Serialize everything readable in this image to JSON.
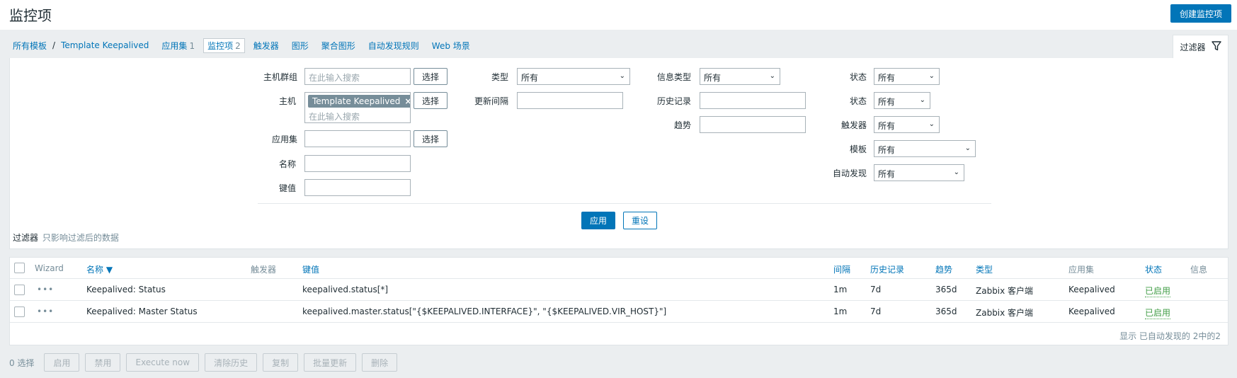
{
  "header": {
    "title": "监控项",
    "create_button": "创建监控项"
  },
  "nav": {
    "breadcrumb": [
      "所有模板",
      "Template Keepalived"
    ],
    "tabs": [
      {
        "label": "应用集",
        "count": "1"
      },
      {
        "label": "监控项",
        "count": "2",
        "active": true
      },
      {
        "label": "触发器"
      },
      {
        "label": "图形"
      },
      {
        "label": "聚合图形"
      },
      {
        "label": "自动发现规则"
      },
      {
        "label": "Web 场景"
      }
    ]
  },
  "filter_tab": {
    "label": "过滤器",
    "icon": "funnel-icon"
  },
  "filter": {
    "host_group": {
      "label": "主机群组",
      "placeholder": "在此输入搜索",
      "select": "选择"
    },
    "host": {
      "label": "主机",
      "tag": "Template Keepalived",
      "placeholder": "在此输入搜索",
      "select": "选择"
    },
    "application": {
      "label": "应用集",
      "value": "",
      "select": "选择"
    },
    "name": {
      "label": "名称",
      "value": ""
    },
    "key": {
      "label": "键值",
      "value": ""
    },
    "type": {
      "label": "类型",
      "value": "所有"
    },
    "update_interval": {
      "label": "更新间隔",
      "value": ""
    },
    "info_type": {
      "label": "信息类型",
      "value": "所有"
    },
    "history": {
      "label": "历史记录",
      "value": ""
    },
    "trends": {
      "label": "趋势",
      "value": ""
    },
    "status": {
      "label": "状态",
      "value": "所有"
    },
    "state": {
      "label": "状态",
      "value": "所有"
    },
    "triggers": {
      "label": "触发器",
      "value": "所有"
    },
    "template": {
      "label": "模板",
      "value": "所有"
    },
    "discovered": {
      "label": "自动发现",
      "value": "所有"
    },
    "apply": "应用",
    "reset": "重设"
  },
  "filter_note": {
    "key": "过滤器",
    "value": "只影响过滤后的数据"
  },
  "table": {
    "headers": {
      "wizard": "Wizard",
      "name": "名称 ▼",
      "triggers": "触发器",
      "key": "键值",
      "interval": "间隔",
      "history": "历史记录",
      "trends": "趋势",
      "type": "类型",
      "applications": "应用集",
      "status": "状态",
      "info": "信息"
    },
    "rows": [
      {
        "wizard": "•••",
        "name": "Keepalived: Status",
        "triggers": "",
        "key": "keepalived.status[*]",
        "interval": "1m",
        "history": "7d",
        "trends": "365d",
        "type": "Zabbix 客户端",
        "applications": "Keepalived",
        "status": "已启用"
      },
      {
        "wizard": "•••",
        "name": "Keepalived: Master Status",
        "triggers": "",
        "key": "keepalived.master.status[\"{$KEEPALIVED.INTERFACE}\", \"{$KEEPALIVED.VIR_HOST}\"]",
        "interval": "1m",
        "history": "7d",
        "trends": "365d",
        "type": "Zabbix 客户端",
        "applications": "Keepalived",
        "status": "已启用"
      }
    ],
    "footer": "显示 已自动发现的 2中的2"
  },
  "action_bar": {
    "selected": "0 选择",
    "buttons": [
      "启用",
      "禁用",
      "Execute now",
      "清除历史",
      "复制",
      "批量更新",
      "删除"
    ]
  },
  "colors": {
    "accent": "#0275b8",
    "enabled": "#429e47",
    "background": "#ebeef0"
  }
}
